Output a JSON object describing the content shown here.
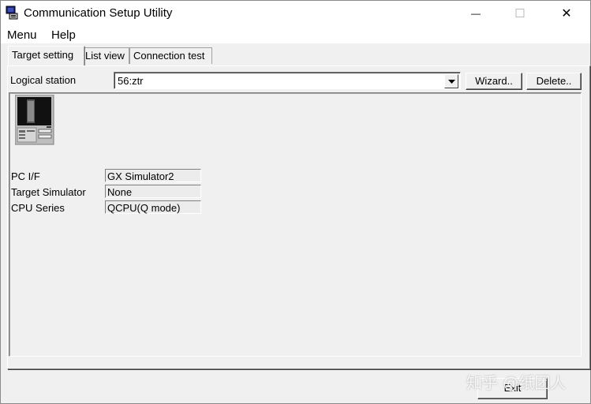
{
  "window": {
    "title": "Communication Setup Utility",
    "minimize_glyph": "—",
    "maximize_glyph": "☐",
    "close_glyph": "✕"
  },
  "menu": {
    "items": [
      "Menu",
      "Help"
    ]
  },
  "tabs": [
    {
      "label": "Target setting",
      "active": true
    },
    {
      "label": "List view",
      "active": false
    },
    {
      "label": "Connection test",
      "active": false
    }
  ],
  "target_setting": {
    "logical_station_label": "Logical station",
    "logical_station_value": "56:ztr",
    "wizard_label": "Wizard..",
    "delete_label": "Delete..",
    "fields": [
      {
        "label": "PC I/F",
        "value": "GX Simulator2"
      },
      {
        "label": "Target Simulator",
        "value": "None"
      },
      {
        "label": "CPU Series",
        "value": "QCPU(Q mode)"
      }
    ],
    "device_icon": "plc-monitor-icon"
  },
  "footer": {
    "exit_label": "Exit"
  },
  "watermark": "知乎 @纸团人"
}
